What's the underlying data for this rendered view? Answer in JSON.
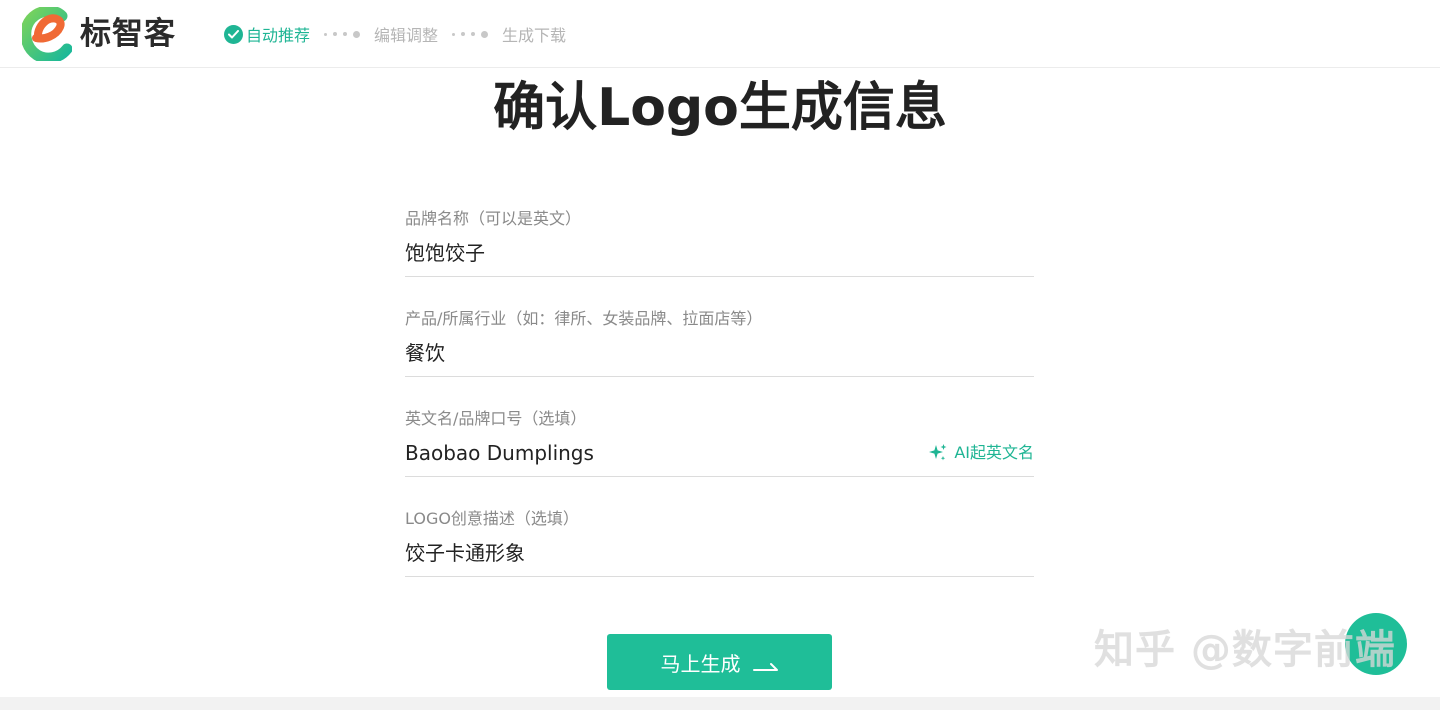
{
  "header": {
    "brand_name": "标智客",
    "steps": [
      {
        "label": "自动推荐",
        "state": "active"
      },
      {
        "label": "编辑调整",
        "state": "pending"
      },
      {
        "label": "生成下载",
        "state": "pending"
      }
    ]
  },
  "page": {
    "title": "确认Logo生成信息"
  },
  "form": {
    "brand_name_label": "品牌名称（可以是英文）",
    "brand_name_value": "饱饱饺子",
    "industry_label": "产品/所属行业（如：律所、女装品牌、拉面店等）",
    "industry_value": "餐饮",
    "english_name_label": "英文名/品牌口号（选填）",
    "english_name_value": "Baobao Dumplings",
    "ai_english_name_label": "AI起英文名",
    "creative_label": "LOGO创意描述（选填）",
    "creative_value": "饺子卡通形象"
  },
  "actions": {
    "generate_label": "马上生成"
  },
  "watermark": "知乎 @数字前端",
  "colors": {
    "accent": "#1fb594",
    "button": "#1fbe98",
    "logo_orange": "#f06a35",
    "logo_green": "#1fbe98"
  },
  "icons": [
    "logo-mark-icon",
    "check-circle-icon",
    "sparkle-icon",
    "arrow-right-icon"
  ]
}
